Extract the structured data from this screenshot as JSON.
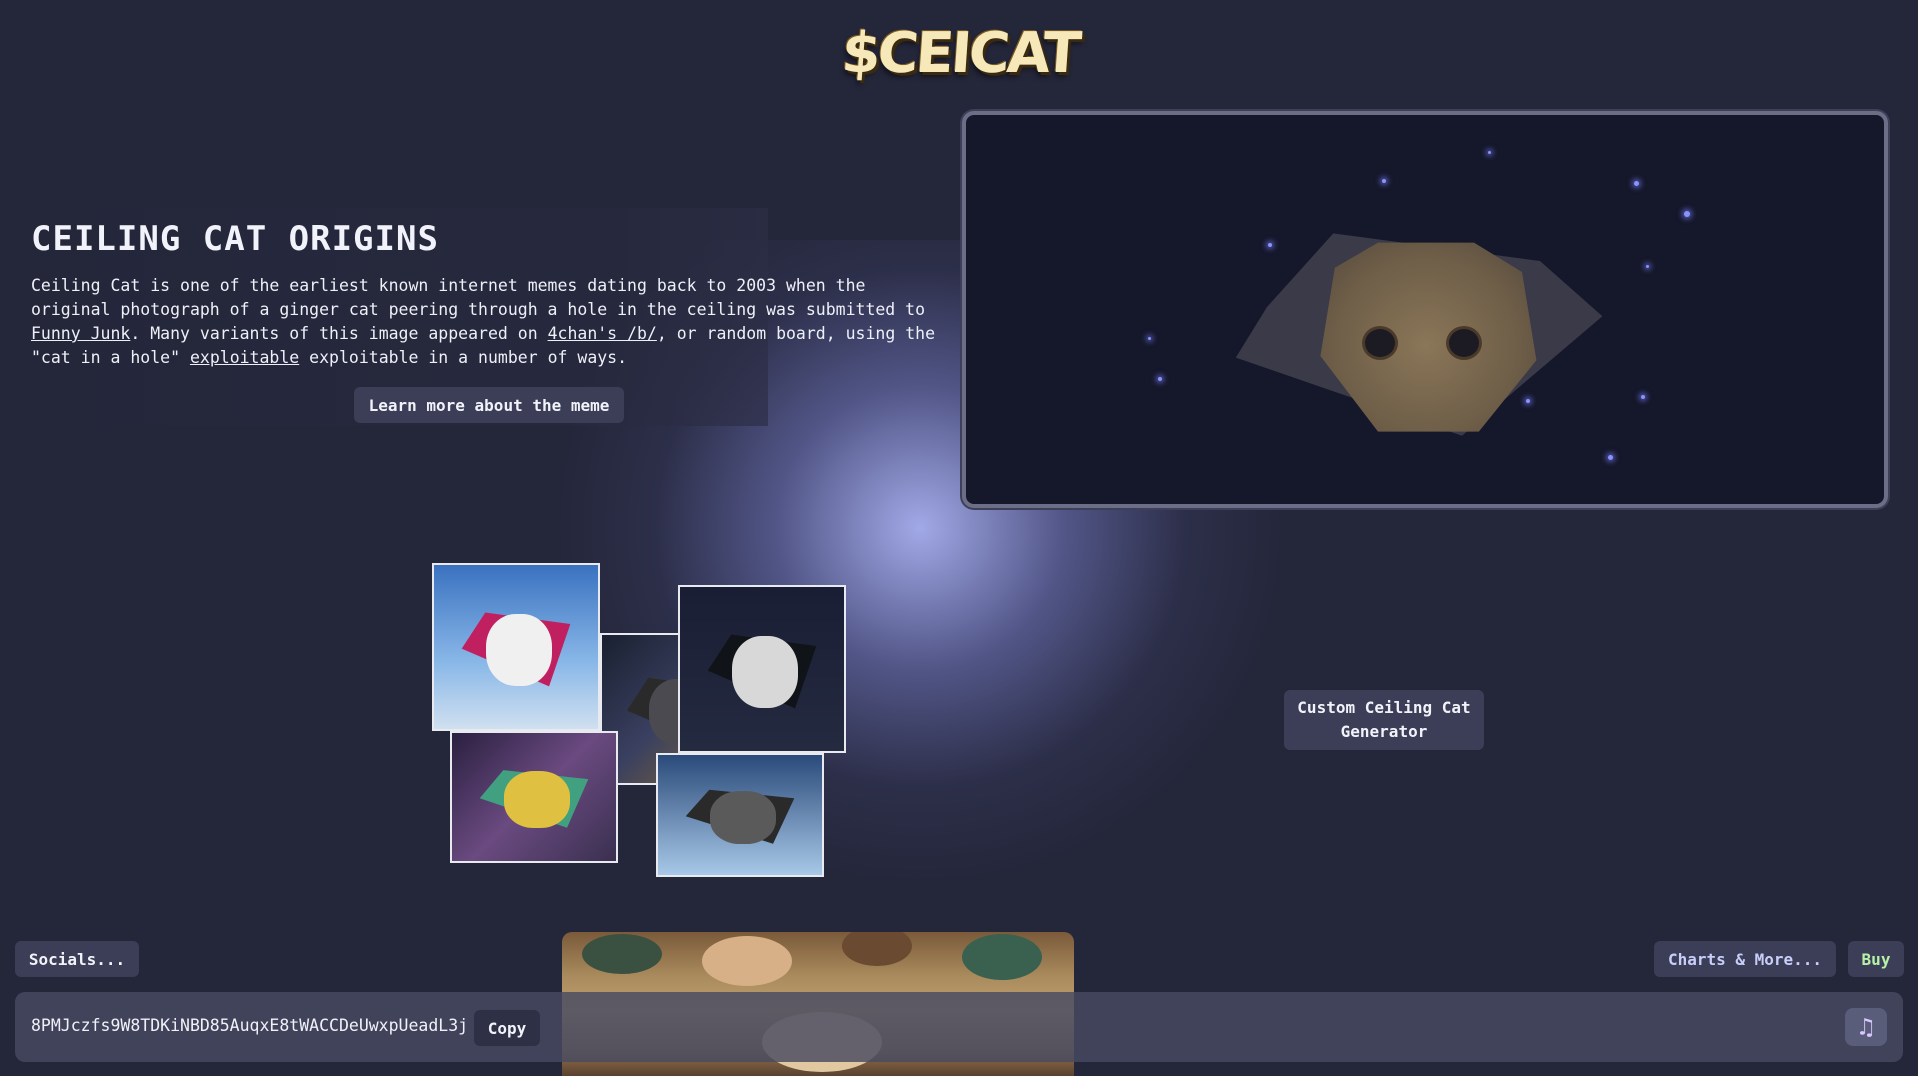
{
  "header": {
    "logo_text": "$CEICAT"
  },
  "origins": {
    "title": "CEILING CAT ORIGINS",
    "text_1": "Ceiling Cat is one of the earliest known internet memes dating back to 2003 when the original photograph of a ginger cat peering through a hole in the ceiling was submitted to ",
    "link_funny_junk": "Funny Junk",
    "text_2": ". Many variants of this image appeared on ",
    "link_4chan": "4chan's /b/",
    "text_3": ", or random board, using the \"cat in a hole\" ",
    "link_exploitable": "exploitable",
    "text_4": " exploitable in a number of ways.",
    "learn_more_label": "Learn more about the meme"
  },
  "generator": {
    "label": "Custom Ceiling Cat Generator"
  },
  "footer": {
    "socials_label": "Socials...",
    "charts_label": "Charts & More...",
    "buy_label": "Buy",
    "contract_address": "8PMJczfs9W8TDKiNBD85AuqxE8tWACCDeUwxpUeadL3j",
    "copy_label": "Copy",
    "music_icon": "music-note-icon"
  },
  "colors": {
    "background": "#24263a",
    "glow": "#a8b0f0",
    "button_bg": "#3b3e56",
    "charts_text": "#c8cef8",
    "buy_text": "#b7f0a8"
  }
}
